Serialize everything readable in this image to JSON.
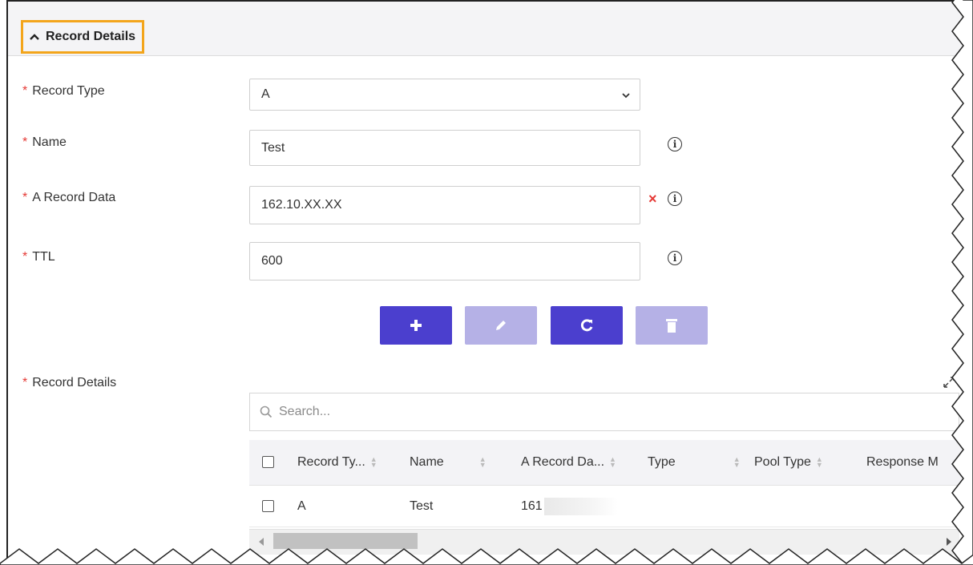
{
  "section": {
    "title": "Record Details"
  },
  "form": {
    "required_mark": "*",
    "record_type": {
      "label": "Record Type",
      "value": "A"
    },
    "name": {
      "label": "Name",
      "value": "Test"
    },
    "a_record_data": {
      "label": "A Record Data",
      "value": "162.10.XX.XX",
      "clear": "×"
    },
    "ttl": {
      "label": "TTL",
      "value": "600"
    },
    "info_glyph": "i"
  },
  "actions": [
    "add-icon",
    "edit-icon",
    "refresh-icon",
    "delete-icon"
  ],
  "record_details": {
    "label": "Record Details",
    "search_placeholder": "Search...",
    "columns": [
      "Record Ty...",
      "Name",
      "A Record Da...",
      "Type",
      "Pool Type",
      "Response M"
    ],
    "rows": [
      {
        "record_type": "A",
        "name": "Test",
        "a_record_data": "161"
      }
    ]
  },
  "colors": {
    "primary": "#4b3fce",
    "primary_disabled": "#b5b1e6",
    "highlight": "#f3a51b",
    "required": "#e53935"
  }
}
